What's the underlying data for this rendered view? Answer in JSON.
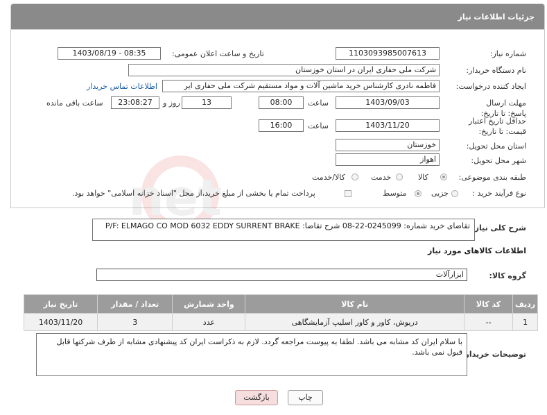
{
  "header": {
    "title": "جزئیات اطلاعات نیاز"
  },
  "form": {
    "need_number_label": "شماره نیاز:",
    "need_number": "1103093985007613",
    "announce_label": "تاریخ و ساعت اعلان عمومی:",
    "announce_value": "1403/08/19 - 08:35",
    "buyer_org_label": "نام دستگاه خریدار:",
    "buyer_org": "شرکت ملی حفاری ایران در استان خوزستان",
    "requester_label": "ایجاد کننده درخواست:",
    "requester": "فاطمه نادری کارشناس خرید ماشین آلات و مواد مستقیم شرکت ملی حفاری ایر",
    "contact_link": "اطلاعات تماس خریدار",
    "deadline_label": "مهلت ارسال پاسخ: تا تاریخ:",
    "deadline_date": "1403/09/03",
    "hour_label": "ساعت",
    "deadline_time": "08:00",
    "days_value": "13",
    "days_label": "روز و",
    "remaining_time": "23:08:27",
    "remaining_label": "ساعت باقی مانده",
    "price_validity_label": "حداقل تاریخ اعتبار قیمت: تا تاریخ:",
    "price_validity_date": "1403/11/20",
    "price_validity_time": "16:00",
    "province_label": "استان محل تحویل:",
    "province": "خوزستان",
    "city_label": "شهر محل تحویل:",
    "city": "اهواز",
    "category_label": "طبقه بندی موضوعی:",
    "category_options": [
      "کالا",
      "خدمت",
      "کالا/خدمت"
    ],
    "process_label": "نوع فرآیند خرید :",
    "process_options": [
      "جزیی",
      "متوسط"
    ],
    "payment_note": "پرداخت تمام یا بخشی از مبلغ خرید،از محل \"اسناد خزانه اسلامی\" خواهد بود."
  },
  "description": {
    "label": "شرح کلی نیاز:",
    "text": "تقاضای خرید شماره: 0245099-22-08    شرح تقاضا: P/F: ELMAGO CO MOD 6032 EDDY SURRENT BRAKE"
  },
  "goods": {
    "section_title": "اطلاعات کالاهای مورد نیاز",
    "group_label": "گروه کالا:",
    "group_value": "ابزارآلات",
    "columns": [
      "ردیف",
      "کد کالا",
      "نام کالا",
      "واحد شمارش",
      "تعداد / مقدار",
      "تاریخ نیاز"
    ],
    "rows": [
      {
        "row": "1",
        "code": "--",
        "name": "دریوش، کاور و کاور اسلیپ آزمایشگاهی",
        "unit": "عدد",
        "qty": "3",
        "date": "1403/11/20"
      }
    ]
  },
  "buyer_notes": {
    "label": "توضیحات خریدار:",
    "text": "با سلام ایران کد مشابه می باشد. لطفا به پیوست مراجعه گردد. لازم به ذکراست ایران کد پیشنهادی مشابه از طرف شرکتها قابل قبول نمی باشد."
  },
  "buttons": {
    "print": "چاپ",
    "back": "بازگشت"
  },
  "watermark_text": "AriaTender.net",
  "colors": {
    "header_bg": "#8a8a8a",
    "link": "#1a5fa8",
    "back_button_bg": "#f7dede"
  }
}
